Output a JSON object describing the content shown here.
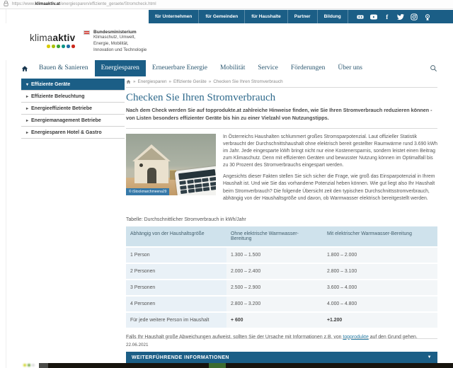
{
  "browser": {
    "url_prefix": "https://www.",
    "url_domain": "klimaaktiv.at",
    "url_path": "/energiesparen/effiziente_geraete/Stromcheck.html"
  },
  "topbar": {
    "items": [
      "für Unternehmen",
      "für Gemeinden",
      "für Haushalte",
      "Partner",
      "Bildung"
    ],
    "social_icon_names": [
      "flickr",
      "youtube",
      "facebook",
      "twitter",
      "instagram",
      "podcast"
    ]
  },
  "header": {
    "logo_part1": "klima",
    "logo_part2": "aktiv",
    "logo_dot_colors": [
      "#d9cb00",
      "#a8c20a",
      "#3fa435",
      "#0e9488",
      "#1e6fa7",
      "#cc2a1d"
    ],
    "ministry_title": "Bundesministerium",
    "ministry_line1": "Klimaschutz, Umwelt,",
    "ministry_line2": "Energie, Mobilität,",
    "ministry_line3": "Innovation und Technologie"
  },
  "mainnav": {
    "items": [
      {
        "label": "Bauen & Sanieren",
        "active": false
      },
      {
        "label": "Energiesparen",
        "active": true
      },
      {
        "label": "Erneuerbare Energie",
        "active": false
      },
      {
        "label": "Mobilität",
        "active": false
      },
      {
        "label": "Service",
        "active": false
      },
      {
        "label": "Förderungen",
        "active": false
      },
      {
        "label": "Über uns",
        "active": false
      }
    ]
  },
  "sidebar": {
    "items": [
      {
        "label": "Effiziente Geräte",
        "arrow": "▾",
        "active": true
      },
      {
        "label": "Effiziente Beleuchtung",
        "arrow": "▸",
        "active": false
      },
      {
        "label": "Energieeffiziente Betriebe",
        "arrow": "▸",
        "active": false
      },
      {
        "label": "Energiemanagement Betriebe",
        "arrow": "▸",
        "active": false
      },
      {
        "label": "Energiesparen Hotel & Gastro",
        "arrow": "▸",
        "active": false
      }
    ]
  },
  "breadcrumb": {
    "separator": "»",
    "items": [
      "Energiesparen",
      "Effiziente Geräte",
      "Checken Sie Ihren Stromverbrauch"
    ]
  },
  "content": {
    "title": "Checken Sie Ihren Stromverbrauch",
    "intro": "Nach dem Check werden Sie auf topprodukte.at zahlreiche Hinweise finden, wie Sie Ihren Stromverbrauch reduzieren können - von Listen besonders effizienter Geräte bis hin zu einer Vielzahl von Nutzungstipps.",
    "image_caption": "© iStockmarchmeena29",
    "paragraph1": "In Österreichs Haushalten schlummert großes Stromsparpotenzial. Laut offizieller Statistik verbraucht der Durchschnittshaushalt ohne elektrisch bereit gestellter Raumwärme rund 3.690 kWh im Jahr. Jede eingesparte kWh bringt nicht nur eine Kostenersparnis, sondern leistet einen Beitrag zum Klimaschutz. Denn mit effizienten Geräten und bewusster Nutzung können im Optimalfall bis zu 30 Prozent des Stromverbrauchs eingespart werden.",
    "paragraph2": "Angesichts dieser Fakten stellen Sie sich sicher die Frage, wie groß das Einsparpotenzial in Ihrem Haushalt ist. Und wie Sie das vorhandene Potenzial heben können. Wie gut liegt also Ihr Haushalt beim Stromverbrauch? Die folgende Übersicht zeit den typischen Durchschnittsstromverbrauch, abhängig von der Haushaltsgröße und davon, ob Warmwasser elektrisch bereitgestellt werden.",
    "table_label": "Tabelle: Durchschnittlicher Stromverbrauch in kWh/Jahr",
    "table": {
      "headers": [
        "Abhängig von der Haushaltsgröße",
        "Ohne elektrische Warmwasser-Bereitung",
        "Mit elektrischer Warmwasser-Bereitung"
      ],
      "rows": [
        [
          "1 Person",
          "1.300 – 1.500",
          "1.800 – 2.000"
        ],
        [
          "2 Personen",
          "2.000 – 2.400",
          "2.800 – 3.100"
        ],
        [
          "3 Personen",
          "2.500 – 2.900",
          "3.600 – 4.000"
        ],
        [
          "4 Personen",
          "2.800 – 3.200",
          "4.000 – 4.800"
        ],
        [
          "Für jede weitere Person im Haushalt",
          "+ 600",
          "+1.200"
        ]
      ]
    },
    "note_before_link": "Falls Ihr Haushalt große Abweichungen aufweist, sollten Sie der Ursache mit Informationen z.B. von ",
    "note_link": "topprodukte",
    "note_after_link": " auf den Grund gehen.",
    "date": "22.06.2021",
    "info_bar_label": "WEITERFÜHRENDE INFORMATIONEN",
    "info_bar_chevron": "▼"
  },
  "colors": {
    "primary_blue": "#1b5e86",
    "link": "#2a7ca3",
    "heading": "#2f6a8c",
    "table_header_bg": "#cfe2ec",
    "table_first_col_bg": "#e9f1f7",
    "table_cell_bg": "#f3f6f8",
    "caption_bg": "#3679a9"
  }
}
